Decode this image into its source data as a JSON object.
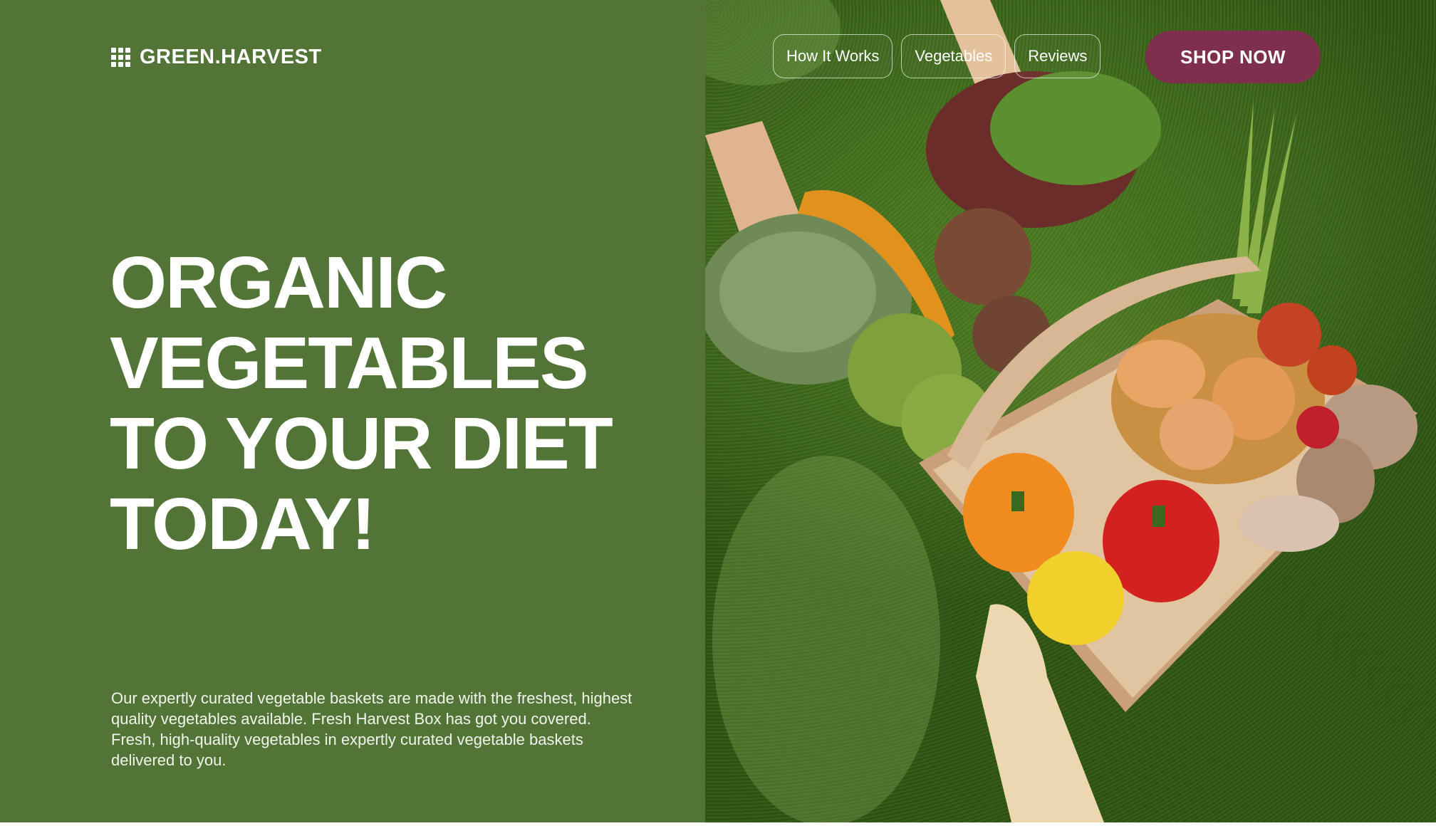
{
  "brand": {
    "name": "GREEN.HARVEST",
    "icon": "grid-icon"
  },
  "nav": {
    "links": [
      {
        "label": "How It Works"
      },
      {
        "label": "Vegetables"
      },
      {
        "label": "Reviews"
      }
    ],
    "cta_label": "SHOP NOW"
  },
  "hero": {
    "headline_lines": [
      "ORGANIC",
      "VEGETABLES",
      "TO YOUR DIET",
      "TODAY!"
    ],
    "description": "Our expertly curated vegetable baskets are made with the freshest, highest quality vegetables available. Fresh Harvest Box has got you covered. Fresh, high-quality vegetables in expertly curated vegetable baskets delivered to you."
  },
  "colors": {
    "panel_green": "#527437",
    "cta_maroon": "#7d2f4d",
    "text_white": "#ffffff"
  }
}
